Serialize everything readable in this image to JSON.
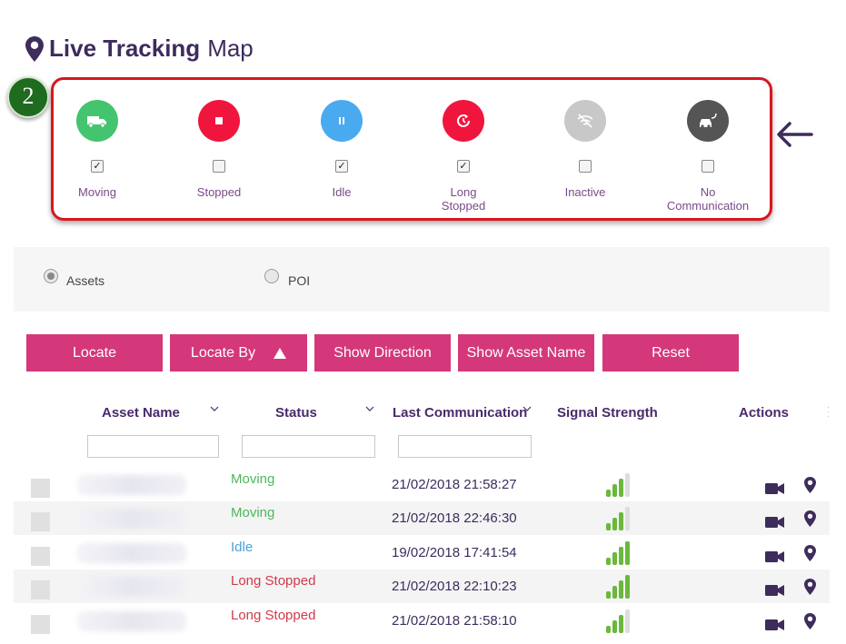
{
  "header": {
    "title_bold": "Live Tracking",
    "title_light": "Map"
  },
  "annotation": {
    "step_number": "2"
  },
  "filters": [
    {
      "label": "Moving",
      "checked": true,
      "color": "#44c46e",
      "icon": "truck-icon"
    },
    {
      "label": "Stopped",
      "checked": false,
      "color": "#f0153c",
      "icon": "stop-icon"
    },
    {
      "label": "Idle",
      "checked": true,
      "color": "#4aaaf0",
      "icon": "pause-icon"
    },
    {
      "label": "Long\nStopped",
      "checked": true,
      "color": "#f0153c",
      "icon": "clock-refresh-icon"
    },
    {
      "label": "Inactive",
      "checked": false,
      "color": "#c8c8c8",
      "icon": "wifi-off-icon"
    },
    {
      "label": "No\nCommunication",
      "checked": false,
      "color": "#555555",
      "icon": "car-plug-icon"
    }
  ],
  "search_type": {
    "options": [
      "Assets",
      "POI"
    ],
    "selected": "Assets"
  },
  "buttons": {
    "locate": "Locate",
    "locate_by": "Locate By",
    "show_direction": "Show Direction",
    "show_asset_name": "Show Asset Name",
    "reset": "Reset"
  },
  "table": {
    "columns": {
      "asset_name": "Asset Name",
      "status": "Status",
      "last_communication": "Last Communication",
      "signal_strength": "Signal Strength",
      "actions": "Actions"
    },
    "rows": [
      {
        "status": "Moving",
        "status_color": "#4cb85c",
        "last_communication": "21/02/2018 21:58:27",
        "signal_bars": 3
      },
      {
        "status": "Moving",
        "status_color": "#4cb85c",
        "last_communication": "21/02/2018 22:46:30",
        "signal_bars": 3
      },
      {
        "status": "Idle",
        "status_color": "#4aa0d8",
        "last_communication": "19/02/2018 17:41:54",
        "signal_bars": 4
      },
      {
        "status": "Long Stopped",
        "status_color": "#d03a4a",
        "last_communication": "21/02/2018 22:10:23",
        "signal_bars": 4
      },
      {
        "status": "Long Stopped",
        "status_color": "#d03a4a",
        "last_communication": "21/02/2018 21:58:10",
        "signal_bars": 3
      }
    ]
  },
  "colors": {
    "accent": "#d4387a",
    "heading": "#4a2a6a",
    "highlight": "#d8161e",
    "signal_on": "#6ab83c",
    "signal_off": "#dddddd"
  }
}
